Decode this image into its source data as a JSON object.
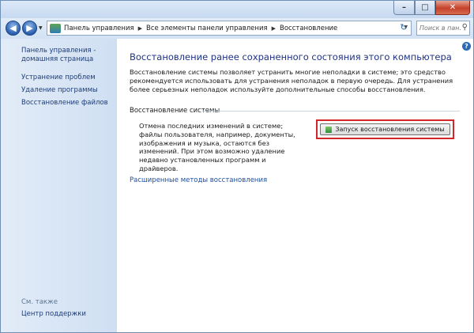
{
  "window": {
    "min_label": "–",
    "max_label": "□",
    "close_label": "✕"
  },
  "nav": {
    "back_glyph": "◀",
    "forward_glyph": "▶",
    "dropdown_glyph": "▼",
    "breadcrumb": [
      "Панель управления",
      "Все элементы панели управления",
      "Восстановление"
    ],
    "breadcrumb_separator": "▶",
    "refresh_glyph": "↻",
    "search_placeholder": "Поиск в пан...",
    "search_glyph": "⚲"
  },
  "sidebar": {
    "items": [
      {
        "label": "Панель управления -"
      },
      {
        "label": "домашняя страница"
      },
      {
        "label": "Устранение проблем"
      },
      {
        "label": "Удаление программы"
      },
      {
        "label": "Восстановление файлов"
      }
    ],
    "see_also_label": "См. также",
    "support_label": "Центр поддержки"
  },
  "main": {
    "help_glyph": "?",
    "title": "Восстановление ранее сохраненного состояния этого компьютера",
    "intro": "Восстановление системы позволяет устранить многие неполадки в системе; это средство рекомендуется использовать для устранения неполадок в первую очередь. Для устранения более серьезных неполадок используйте дополнительные способы восстановления.",
    "group_title": "Восстановление системы",
    "group_desc": "Отмена последних изменений в системе; файлы пользователя, например, документы, изображения и музыка, остаются без изменений. При этом возможно удаление недавно установленных программ и драйверов.",
    "start_button_label": "Запуск восстановления системы",
    "advanced_link": "Расширенные методы восстановления"
  },
  "colors": {
    "highlight_outline": "#d2262a",
    "link": "#1c3c78",
    "title": "#1e3287"
  }
}
